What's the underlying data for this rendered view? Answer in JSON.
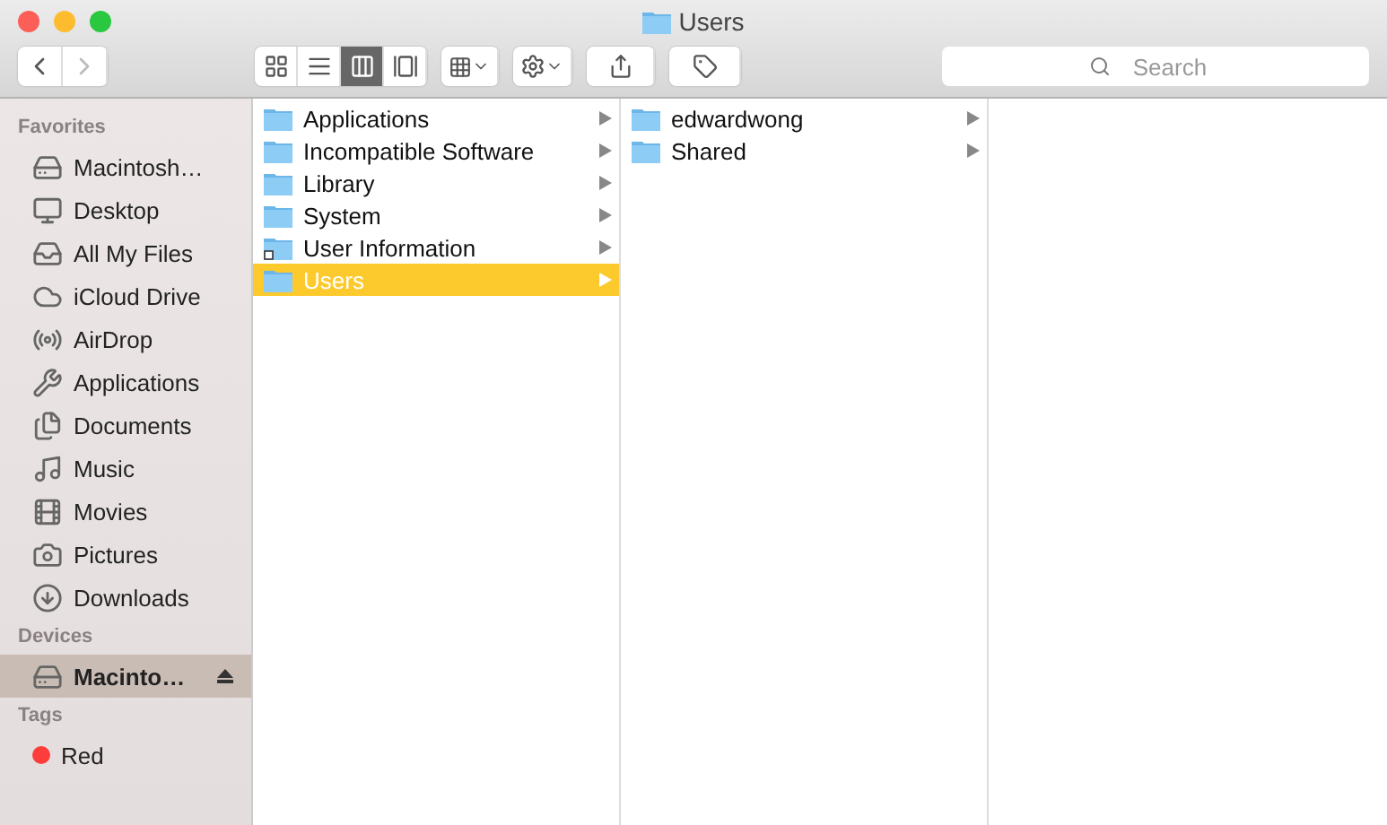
{
  "window": {
    "title": "Users"
  },
  "toolbar": {
    "view_modes": [
      {
        "kind": "icons",
        "selected": false
      },
      {
        "kind": "list",
        "selected": false
      },
      {
        "kind": "columns",
        "selected": true
      },
      {
        "kind": "coverflow",
        "selected": false
      }
    ],
    "search": {
      "placeholder": "Search"
    }
  },
  "sidebar": {
    "sections": [
      {
        "title": "Favorites",
        "items": [
          {
            "label": "Macintosh…",
            "kind": "disk",
            "selected": false
          },
          {
            "label": "Desktop",
            "kind": "desktop",
            "selected": false
          },
          {
            "label": "All My Files",
            "kind": "files",
            "selected": false
          },
          {
            "label": "iCloud Drive",
            "kind": "cloud",
            "selected": false
          },
          {
            "label": "AirDrop",
            "kind": "airdrop",
            "selected": false
          },
          {
            "label": "Applications",
            "kind": "apps",
            "selected": false
          },
          {
            "label": "Documents",
            "kind": "docs",
            "selected": false
          },
          {
            "label": "Music",
            "kind": "music",
            "selected": false
          },
          {
            "label": "Movies",
            "kind": "movies",
            "selected": false
          },
          {
            "label": "Pictures",
            "kind": "pictures",
            "selected": false
          },
          {
            "label": "Downloads",
            "kind": "downloads",
            "selected": false
          }
        ]
      },
      {
        "title": "Devices",
        "items": [
          {
            "label": "Macinto…",
            "kind": "disk",
            "selected": true,
            "eject": true
          }
        ]
      },
      {
        "title": "Tags",
        "items": [
          {
            "label": "Red",
            "kind": "tag",
            "selected": false,
            "color": "#fc3d39"
          }
        ]
      }
    ]
  },
  "columns": [
    {
      "items": [
        {
          "name": "Applications",
          "alias": false,
          "selected": false
        },
        {
          "name": "Incompatible Software",
          "alias": false,
          "selected": false
        },
        {
          "name": "Library",
          "alias": false,
          "selected": false
        },
        {
          "name": "System",
          "alias": false,
          "selected": false
        },
        {
          "name": "User Information",
          "alias": true,
          "selected": false
        },
        {
          "name": "Users",
          "alias": false,
          "selected": true
        }
      ]
    },
    {
      "items": [
        {
          "name": "edwardwong",
          "alias": false,
          "selected": false
        },
        {
          "name": "Shared",
          "alias": false,
          "selected": false
        }
      ]
    }
  ]
}
